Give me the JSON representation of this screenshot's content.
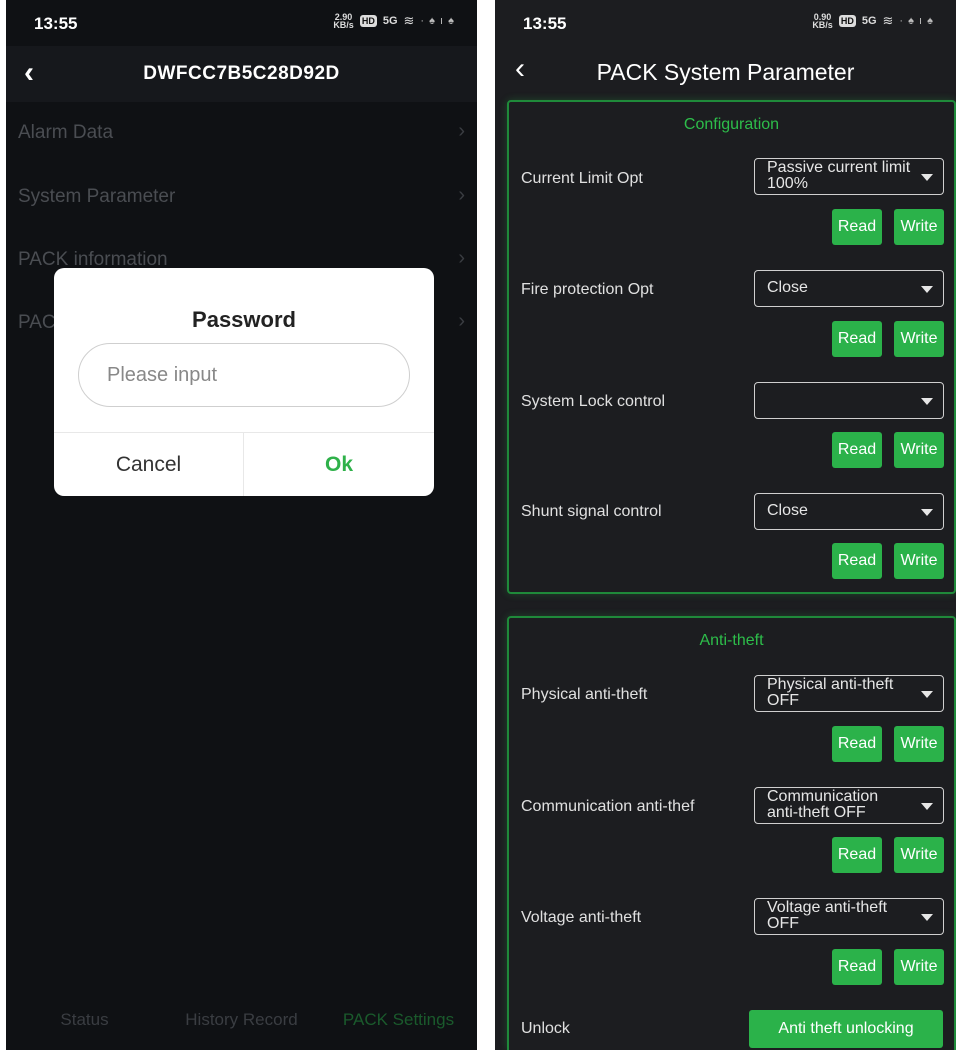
{
  "left": {
    "status": {
      "time": "13:55",
      "speed_value": "2.90",
      "speed_unit": "KB/s",
      "hd": "HD",
      "signal": "5G",
      "wifi": "wifi-icon",
      "extra": "· ♠ ı ♠"
    },
    "header": {
      "back": "‹",
      "title": "DWFCC7B5C28D92D"
    },
    "menu": [
      {
        "label": "Alarm Data",
        "chevron": "›"
      },
      {
        "label": "System Parameter",
        "chevron": "›"
      },
      {
        "label": "PACK information",
        "chevron": "›"
      },
      {
        "label": "PAC",
        "chevron": "›"
      }
    ],
    "dialog": {
      "title": "Password",
      "placeholder": "Please input",
      "cancel": "Cancel",
      "ok": "Ok"
    },
    "nav": {
      "status": "Status",
      "history": "History Record",
      "pack": "PACK Settings"
    }
  },
  "right": {
    "status": {
      "time": "13:55",
      "speed_value": "0.90",
      "speed_unit": "KB/s",
      "hd": "HD",
      "signal": "5G",
      "wifi": "wifi-icon",
      "extra": "· ♠ ı ♠"
    },
    "header": {
      "back": "‹",
      "title": "PACK System Parameter"
    },
    "configuration": {
      "title": "Configuration",
      "items": [
        {
          "label": "Current Limit Opt",
          "value": "Passive current limit 100%",
          "read": "Read",
          "write": "Write"
        },
        {
          "label": "Fire protection Opt",
          "value": "Close",
          "read": "Read",
          "write": "Write"
        },
        {
          "label": "System Lock control",
          "value": "",
          "read": "Read",
          "write": "Write"
        },
        {
          "label": "Shunt signal control",
          "value": "Close",
          "read": "Read",
          "write": "Write"
        }
      ]
    },
    "antitheft": {
      "title": "Anti-theft",
      "items": [
        {
          "label": "Physical anti-theft",
          "value": "Physical anti-theft OFF",
          "read": "Read",
          "write": "Write"
        },
        {
          "label": "Communication anti-thef",
          "value": "Communication anti-theft OFF",
          "read": "Read",
          "write": "Write"
        },
        {
          "label": "Voltage anti-theft",
          "value": "Voltage anti-theft OFF",
          "read": "Read",
          "write": "Write"
        }
      ]
    },
    "unlock": {
      "label": "Unlock",
      "button": "Anti theft unlocking"
    }
  },
  "colors": {
    "accent": "#2bb24a",
    "ok_text": "#2fb14a",
    "panel_border": "#1f8a3a"
  }
}
